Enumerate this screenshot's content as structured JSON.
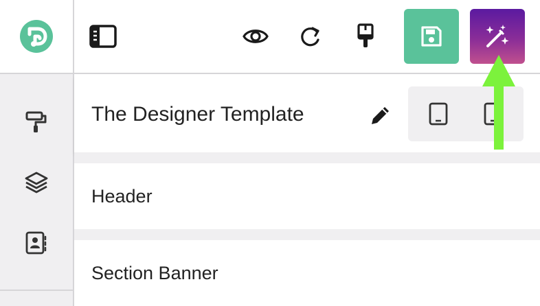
{
  "app": {
    "logo_letter": "D"
  },
  "sidebar": {
    "items": [
      {
        "name": "style",
        "icon": "paint-roller-icon"
      },
      {
        "name": "layers",
        "icon": "layers-icon"
      },
      {
        "name": "contacts",
        "icon": "contact-book-icon"
      }
    ]
  },
  "toolbar": {
    "buttons": [
      {
        "name": "toggle-sidebar",
        "icon": "sidebar-toggle-icon"
      },
      {
        "name": "preview",
        "icon": "eye-icon"
      },
      {
        "name": "redo",
        "icon": "redo-icon"
      },
      {
        "name": "brush",
        "icon": "paint-brush-icon"
      },
      {
        "name": "save",
        "icon": "save-icon"
      },
      {
        "name": "ai-magic",
        "icon": "magic-wand-icon"
      }
    ]
  },
  "panel": {
    "title": "The Designer Template",
    "edit_icon": "pencil-icon",
    "devices": [
      {
        "name": "tablet-portrait",
        "icon": "tablet-icon"
      },
      {
        "name": "tablet-portrait-alt",
        "icon": "tablet-icon"
      }
    ]
  },
  "sections": [
    {
      "label": "Header"
    },
    {
      "label": "Section Banner"
    }
  ],
  "colors": {
    "accent_green": "#5ac29a",
    "magic_gradient_top": "#5b1aa0",
    "magic_gradient_bottom": "#c0508e",
    "annotation_arrow": "#7cf23c",
    "rail_bg": "#f0eff1"
  }
}
